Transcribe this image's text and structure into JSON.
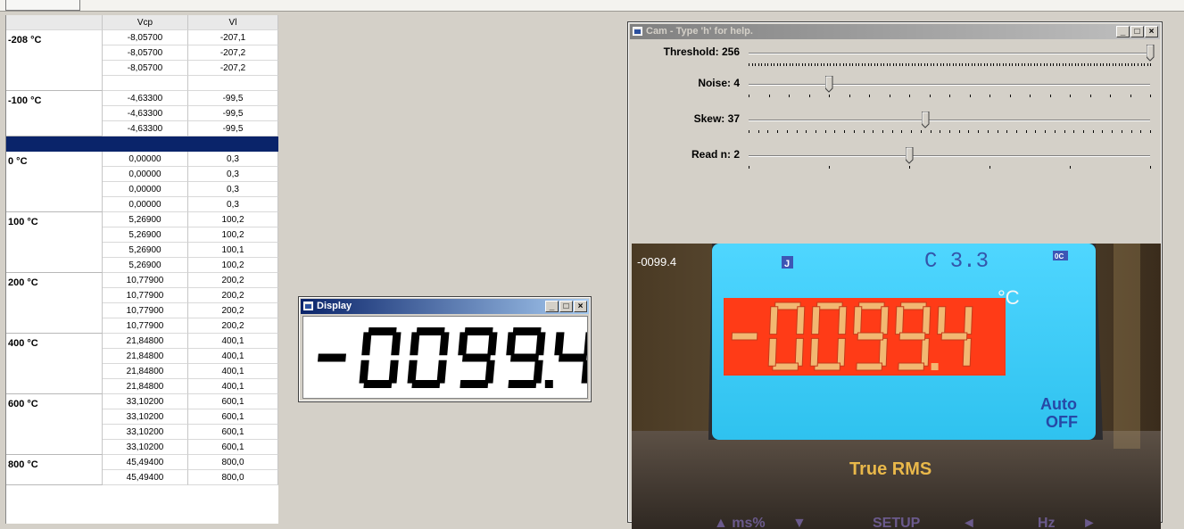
{
  "table": {
    "headers": [
      "",
      "Vcp",
      "Vl"
    ],
    "groups": [
      {
        "label": "-208 °C",
        "rows": [
          [
            "-8,05700",
            "-207,1"
          ],
          [
            "-8,05700",
            "-207,2"
          ],
          [
            "-8,05700",
            "-207,2"
          ],
          [
            "",
            ""
          ]
        ]
      },
      {
        "label": "-100 °C",
        "rows": [
          [
            "-4,63300",
            "-99,5"
          ],
          [
            "-4,63300",
            "-99,5"
          ],
          [
            "-4,63300",
            "-99,5"
          ]
        ]
      },
      {
        "label": "",
        "selected": true,
        "rows": [
          [
            "",
            ""
          ]
        ]
      },
      {
        "label": "0 °C",
        "rows": [
          [
            "0,00000",
            "0,3"
          ],
          [
            "0,00000",
            "0,3"
          ],
          [
            "0,00000",
            "0,3"
          ],
          [
            "0,00000",
            "0,3"
          ]
        ]
      },
      {
        "label": "100 °C",
        "rows": [
          [
            "5,26900",
            "100,2"
          ],
          [
            "5,26900",
            "100,2"
          ],
          [
            "5,26900",
            "100,1"
          ],
          [
            "5,26900",
            "100,2"
          ]
        ]
      },
      {
        "label": "200 °C",
        "rows": [
          [
            "10,77900",
            "200,2"
          ],
          [
            "10,77900",
            "200,2"
          ],
          [
            "10,77900",
            "200,2"
          ],
          [
            "10,77900",
            "200,2"
          ]
        ]
      },
      {
        "label": "400 °C",
        "rows": [
          [
            "21,84800",
            "400,1"
          ],
          [
            "21,84800",
            "400,1"
          ],
          [
            "21,84800",
            "400,1"
          ],
          [
            "21,84800",
            "400,1"
          ]
        ]
      },
      {
        "label": "600 °C",
        "rows": [
          [
            "33,10200",
            "600,1"
          ],
          [
            "33,10200",
            "600,1"
          ],
          [
            "33,10200",
            "600,1"
          ],
          [
            "33,10200",
            "600,1"
          ]
        ]
      },
      {
        "label": "800 °C",
        "rows": [
          [
            "45,49400",
            "800,0"
          ],
          [
            "45,49400",
            "800,0"
          ]
        ]
      }
    ]
  },
  "display_window": {
    "title": "Display",
    "reading": "-0099.4"
  },
  "cam_window": {
    "title": "Cam - Type 'h' for help.",
    "sliders": [
      {
        "label": "Threshold: 256",
        "value": 256,
        "max": 256
      },
      {
        "label": "Noise: 4",
        "value": 4,
        "max": 20
      },
      {
        "label": "Skew: 37",
        "value": 37,
        "max": 84
      },
      {
        "label": "Read n: 2",
        "value": 2,
        "max": 5
      }
    ],
    "camera": {
      "overlay_reading": "-0099.4",
      "lcd_digits": "-0099.4",
      "unit": "°C",
      "top_digits": "C 3.3",
      "badge_j": "J",
      "badge_oc": "0C",
      "auto_line1": "Auto",
      "auto_line2": "OFF",
      "brand": "True RMS",
      "bottom_labels": [
        "▲ ms%",
        "▼",
        "SETUP",
        "◄",
        "Hz",
        "►"
      ]
    }
  },
  "window_buttons": {
    "min": "_",
    "max": "□",
    "close": "×"
  }
}
